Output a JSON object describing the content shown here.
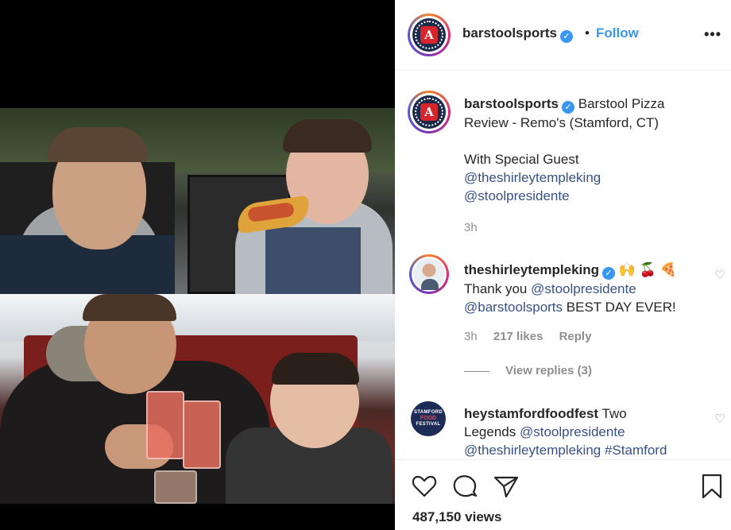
{
  "post": {
    "username": "barstoolsports",
    "verified_glyph": "✓",
    "separator": "•",
    "follow_label": "Follow",
    "more_label": "•••",
    "avatar_icon": "barstool-logo-icon"
  },
  "caption": {
    "username": "barstoolsports",
    "text_line1": "Barstool Pizza",
    "text_line2": "Review - Remo's (Stamford, CT)",
    "text_line3": "With Special Guest",
    "mention1": "@theshirleytempleking",
    "mention2": "@stoolpresidente",
    "time": "3h"
  },
  "comments": [
    {
      "username": "theshirleytempleking",
      "emojis": "🙌 🍒 🍕",
      "text_prefix": "Thank you",
      "mention1": "@stoolpresidente",
      "mention2": "@barstoolsports",
      "text_suffix": "BEST DAY EVER!",
      "time": "3h",
      "likes": "217 likes",
      "reply_label": "Reply",
      "view_replies": "View replies (3)"
    },
    {
      "username": "heystamfordfoodfest",
      "text_prefix": "Two",
      "text_line2_prefix": "Legends",
      "mention1": "@stoolpresidente",
      "mention2": "@theshirleytempleking",
      "hashtag": "#Stamford",
      "avatar_top": "STAMFORD",
      "avatar_mid": "FOOD",
      "avatar_bottom": "FESTIVAL"
    }
  ],
  "actions": {
    "like_icon": "heart-icon",
    "comment_icon": "comment-icon",
    "share_icon": "share-icon",
    "save_icon": "bookmark-icon",
    "views": "487,150 views"
  },
  "colors": {
    "accent": "#3897f0",
    "text": "#262626",
    "secondary": "#8e8e8e",
    "mention": "#385185"
  }
}
